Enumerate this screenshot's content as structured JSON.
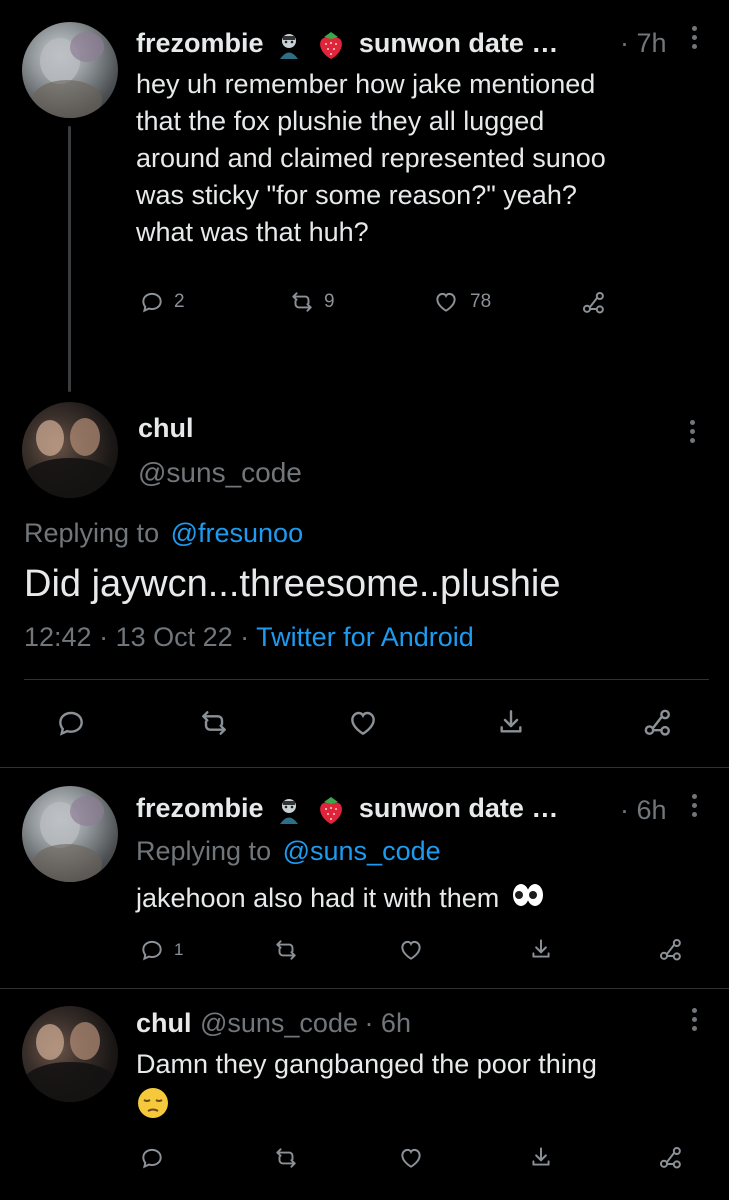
{
  "tweet1": {
    "display_name": "frezombie",
    "handle_trunc": "sunwon date …",
    "time": "· 7h",
    "text_lines": [
      "hey uh remember how jake mentioned",
      "that the fox plushie they all lugged",
      "around and claimed represented sunoo",
      "was sticky \"for some reason?\" yeah?",
      "what was that huh?"
    ],
    "replies": "2",
    "retweets": "9",
    "likes": "78"
  },
  "focus": {
    "display_name": "chul",
    "handle": "@suns_code",
    "replying_prefix": "Replying to",
    "replying_handle": "@fresunoo",
    "text": "Did jaywcn...threesome..plushie",
    "time": "12:42",
    "date": "· 13 Oct 22 ·",
    "client": "Twitter for Android"
  },
  "reply1": {
    "display_name": "frezombie",
    "handle_trunc": "sunwon date …",
    "time": "· 6h",
    "replying_prefix": "Replying to",
    "replying_handle": "@suns_code",
    "text": "jakehoon also had it with them",
    "replies": "1"
  },
  "reply2": {
    "display_name": "chul",
    "handle": "@suns_code",
    "time": "· 6h",
    "text": "Damn they gangbanged the poor thing"
  },
  "colors": {
    "background": "#000000",
    "text": "#e7e9ea",
    "muted": "#71767b",
    "link": "#1d9bf0"
  },
  "icons": [
    "reply-icon",
    "retweet-icon",
    "like-icon",
    "share-icon",
    "more-icon",
    "strawberry-icon",
    "zombie-icon",
    "eyes-icon",
    "pensive-face-icon"
  ]
}
